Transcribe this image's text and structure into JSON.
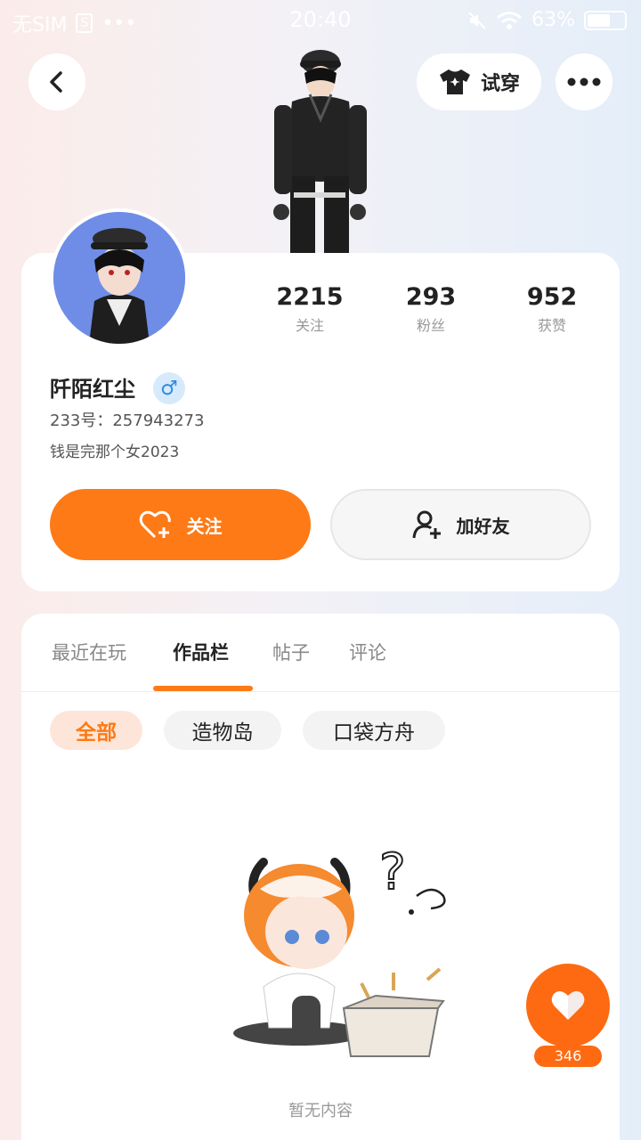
{
  "status_bar": {
    "carrier": "无SIM",
    "sim_label": "S",
    "dots": "•••",
    "time": "20:40",
    "battery": "63%",
    "battery_level": 0.63,
    "icons": [
      "mute-icon",
      "wifi-icon",
      "battery-icon"
    ]
  },
  "header": {
    "back_icon": "chevron-left-icon",
    "tryon_label": "试穿",
    "tryon_icon": "shirt-icon",
    "more_icon": "more-icon"
  },
  "profile": {
    "username": "阡陌红尘",
    "gender_symbol": "♂",
    "uid_text": "233号：257943273",
    "bio": "钱是完那个女2023",
    "stats": [
      {
        "value": "2215",
        "label": "关注"
      },
      {
        "value": "293",
        "label": "粉丝"
      },
      {
        "value": "952",
        "label": "获赞"
      }
    ],
    "follow_label": "关注",
    "add_friend_label": "加好友"
  },
  "tabs": [
    {
      "label": "最近在玩",
      "active": false
    },
    {
      "label": "作品栏",
      "active": true
    },
    {
      "label": "帖子",
      "active": false
    },
    {
      "label": "评论",
      "active": false
    }
  ],
  "filters": [
    {
      "label": "全部",
      "active": true
    },
    {
      "label": "造物岛",
      "active": false
    },
    {
      "label": "口袋方舟",
      "active": false
    }
  ],
  "empty_state": {
    "text": "暂无内容"
  },
  "like_fab": {
    "count": "346"
  },
  "colors": {
    "accent": "#fd7a16",
    "gender": "#2f8be0"
  }
}
